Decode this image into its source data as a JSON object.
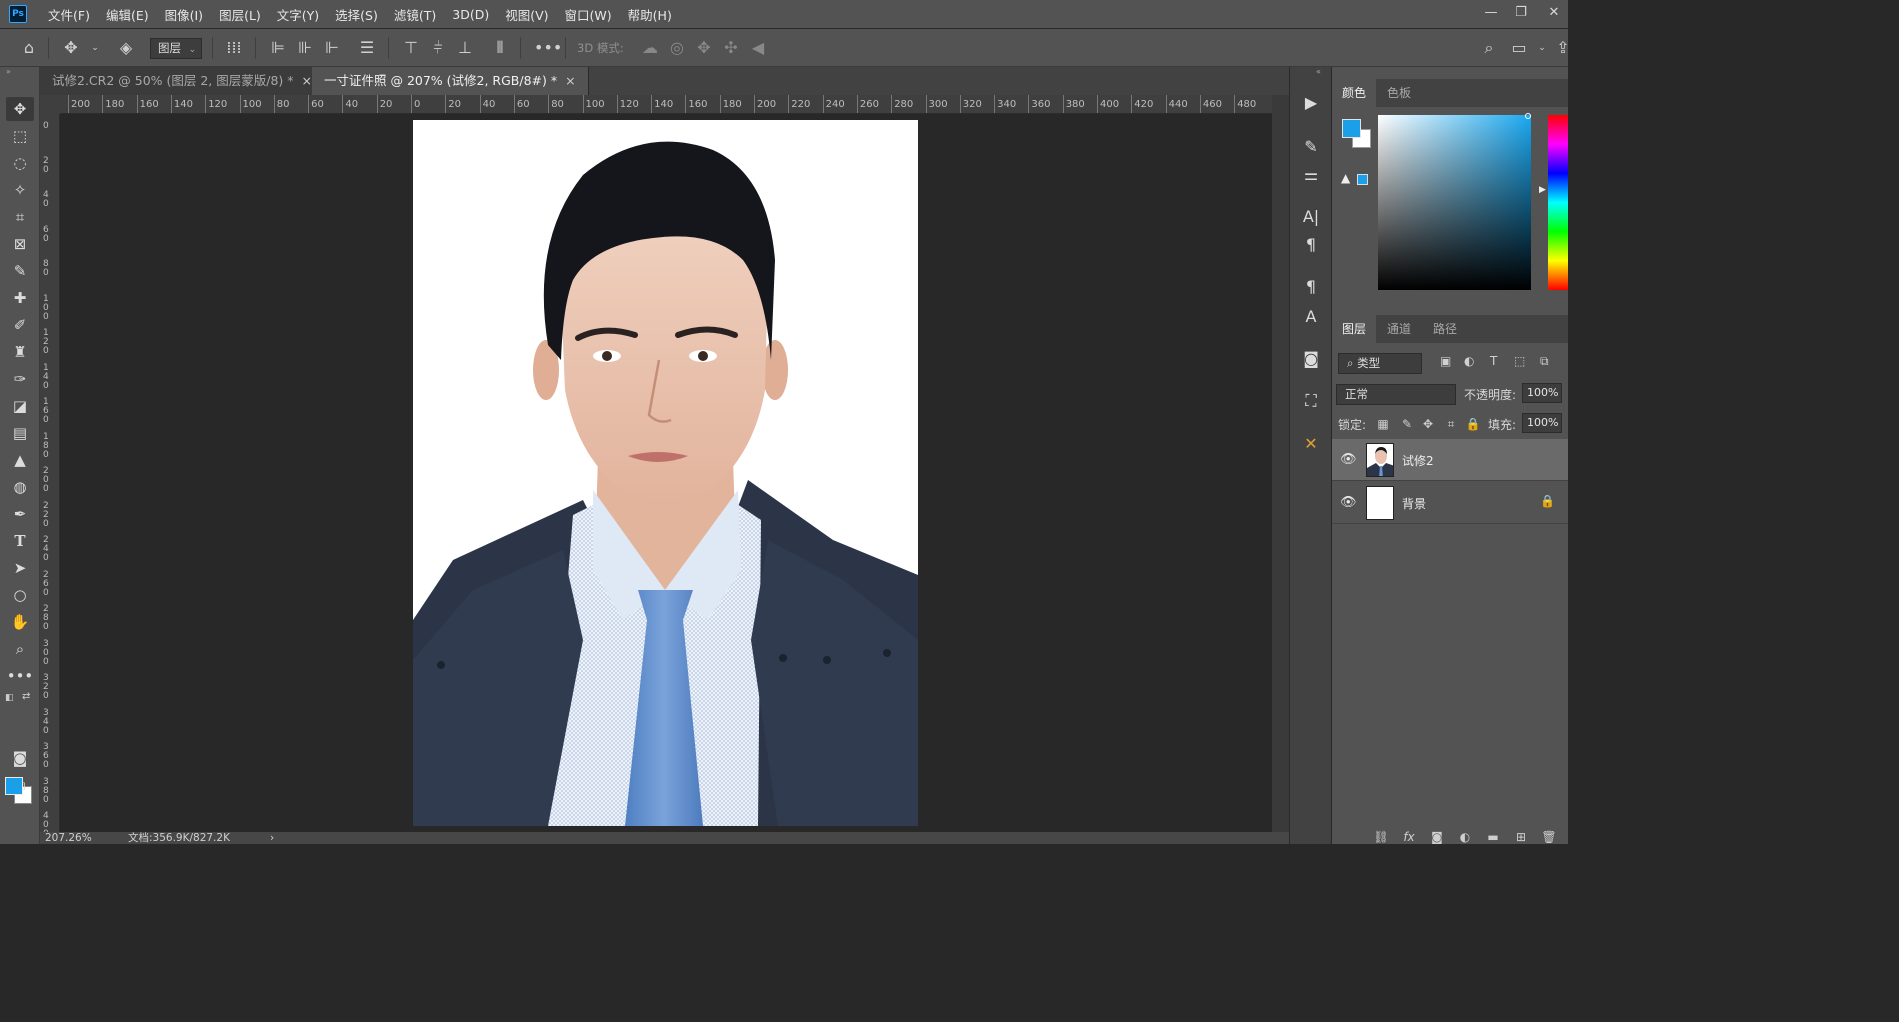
{
  "app": {
    "logo": "Ps",
    "menu": [
      "文件(F)",
      "编辑(E)",
      "图像(I)",
      "图层(L)",
      "文字(Y)",
      "选择(S)",
      "滤镜(T)",
      "3D(D)",
      "视图(V)",
      "窗口(W)",
      "帮助(H)"
    ],
    "window_controls": [
      "minimize-icon",
      "restore-icon",
      "close-icon"
    ]
  },
  "options_bar": {
    "layer_select": "图层",
    "mode_3d_label": "3D 模式:",
    "icons": [
      "home-icon",
      "move-tool-icon",
      "layers-stack-icon",
      "align-icons",
      "more-icon",
      "search-icon",
      "workspace-icon",
      "share-icon"
    ]
  },
  "tabs": [
    {
      "label": "试修2.CR2 @ 50% (图层 2, 图层蒙版/8) *",
      "close": "×",
      "active": false
    },
    {
      "label": "一寸证件照 @ 207% (试修2, RGB/8#) *",
      "close": "×",
      "active": true
    }
  ],
  "ruler": {
    "h_ticks": [
      "200",
      "180",
      "160",
      "140",
      "120",
      "100",
      "80",
      "60",
      "40",
      "20",
      "0",
      "20",
      "40",
      "60",
      "80",
      "100",
      "120",
      "140",
      "160",
      "180",
      "200",
      "220",
      "240",
      "260",
      "280",
      "300",
      "320",
      "340",
      "360",
      "380",
      "400",
      "420",
      "440",
      "460",
      "480"
    ],
    "v_ticks": [
      "0",
      "20",
      "40",
      "60",
      "80",
      "100",
      "120",
      "140",
      "160",
      "180",
      "200",
      "220",
      "240",
      "260",
      "280",
      "300",
      "320",
      "340",
      "360",
      "380",
      "400"
    ]
  },
  "status": {
    "zoom": "207.26%",
    "doc": "文档:356.9K/827.2K",
    "arrow": "›"
  },
  "colors": {
    "foreground": "#1a9fe8",
    "background": "#ffffff",
    "accent": "#31a8ff"
  },
  "color_panel": {
    "tabs": [
      "颜色",
      "色板"
    ]
  },
  "layers_panel": {
    "tabs": [
      "图层",
      "通道",
      "路径"
    ],
    "filter_label": "类型",
    "blend_mode": "正常",
    "opacity_label": "不透明度:",
    "opacity_value": "100%",
    "lock_label": "锁定:",
    "fill_label": "填充:",
    "fill_value": "100%",
    "layers": [
      {
        "name": "试修2",
        "visible": true,
        "selected": true,
        "locked": false
      },
      {
        "name": "背景",
        "visible": true,
        "selected": false,
        "locked": true
      }
    ]
  }
}
